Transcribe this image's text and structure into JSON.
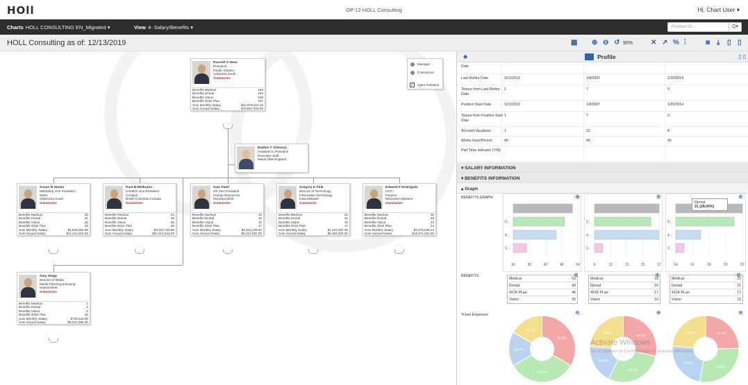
{
  "app": {
    "logo": "HOll",
    "title": "OP 12-HOLL Consulting",
    "user_menu": "Hi, Chart User ▾"
  },
  "nav": {
    "charts_label": "Charts",
    "charts_value": "HOLL CONSULTING EN_Migrated ▾",
    "view_label": "View",
    "view_value": "4- Salary/Benefits ▾",
    "position_id_placeholder": "Position ID...",
    "search_btn": "Q▾"
  },
  "page": {
    "title": "HOLL Consulting as of: 12/13/2019",
    "zoom": "90%"
  },
  "legend": {
    "manager": "Manager",
    "contractors": "Contractors",
    "open_positions": "Open Positions"
  },
  "row_labels": {
    "medical": "Benefits Medical",
    "dental": "Benefits Dental",
    "vision": "Benefits Vision",
    "k401": "Benefits 401K Plan",
    "monthly": "Sum Monthly Salary",
    "annual": "Sum Annual Salary",
    "summaries": "Summaries"
  },
  "cards": [
    {
      "name": "Russell O Hess",
      "l1": "President",
      "l2": "Pacific Eastern",
      "l3": "Arkansas,South",
      "medical": "156",
      "dental": "150",
      "vision": "108",
      "k401": "157",
      "monthly": "$10,978,210.26",
      "annual": "$79,857,403.00"
    },
    {
      "name": "Bobbie T Johnson",
      "l1": "Assistant to President",
      "l2": "Executive Staff",
      "l3": "Maine,New England"
    },
    {
      "name": "Susan N Hester",
      "l1": "Marketing Vice President",
      "l2": "Sales",
      "l3": "Oklahoma,South",
      "medical": "33",
      "dental": "31",
      "vision": "20",
      "k401": "25",
      "monthly": "$1,848,084.50",
      "annual": "$14,421,815.00"
    },
    {
      "name": "Paul M Melbrann",
      "l1": "Creative Vice President",
      "l2": "Creative",
      "l3": "British Columbia,Canada",
      "medical": "52",
      "dental": "49",
      "vision": "35",
      "k401": "46",
      "monthly": "$3,316,760.88",
      "annual": "$21,017,541.00"
    },
    {
      "name": "Sam Patel",
      "l1": "HR Vice President",
      "l2": "Human Resources",
      "l3": "Montana,West",
      "medical": "18",
      "dental": "16",
      "vision": "10",
      "k401": "17",
      "monthly": "$1,044,228.60",
      "annual": "$6,417,097.00"
    },
    {
      "name": "Gregory K Fink",
      "l1": "Director of Technology",
      "l2": "Information Technology",
      "l3": "Iowa,Midwest",
      "medical": "22",
      "dental": "21",
      "vision": "15",
      "k401": "17",
      "monthly": "$1,315,397.05",
      "annual": "$9,384,600.00"
    },
    {
      "name": "Edward P Rodriguez",
      "l1": "CFO",
      "l2": "Finance",
      "l3": "Wisconsin,Midwest",
      "medical": "30",
      "dental": "30",
      "vision": "23",
      "k401": "34",
      "monthly": "$2,370,236.24",
      "annual": "$16,871,911.00"
    },
    {
      "name": "Amy Stepp",
      "l1": "Director of Media",
      "l2": "Media Planning & Buying",
      "l3": "Hawaii,West",
      "medical": "1",
      "dental": "1",
      "vision": "0",
      "k401": "15",
      "monthly": "$728,540.00",
      "annual": "$9,521,056.00"
    }
  ],
  "profile": {
    "title": "Profile",
    "rows": [
      {
        "label": "Date",
        "v": [
          "",
          "",
          ""
        ]
      },
      {
        "label": "Last Rehire Date",
        "v": [
          "3/11/2013",
          "1/8/2007",
          "1/20/2014"
        ]
      },
      {
        "label": "Tenure from Last Rehire Date",
        "v": [
          "1",
          "7",
          "0"
        ]
      },
      {
        "label": "Position Start Date",
        "v": [
          "3/11/2013",
          "1/8/2007",
          "1/20/2014"
        ]
      },
      {
        "label": "Tenure from Position Start Date",
        "v": [
          "1",
          "7",
          "0"
        ]
      },
      {
        "label": "Accrued Vacations",
        "v": [
          "1",
          "12",
          "8"
        ]
      },
      {
        "label": "Works Hour/Period",
        "v": [
          "40",
          "40",
          "40"
        ]
      },
      {
        "label": "Part Time indicator (Y/N)",
        "v": [
          "",
          "",
          ""
        ]
      }
    ],
    "sections": {
      "salary": "SALARY INFORMATION",
      "benefits": "BENEFITS INFORMATION",
      "graph": "Graph"
    },
    "benefits_graph_label": "BENEFITS GRAPH",
    "benefits_label": "BENEFITS",
    "travel_label": "Travel Expenses",
    "tooltip": {
      "line1": "Dental",
      "line2": "21 (28.00%)"
    },
    "watermark": {
      "line1": "Activate Windows",
      "line2": "Go to System in Control Panel to activate Windows."
    }
  },
  "benefit_tables": [
    [
      {
        "k": "Medical",
        "v": "52"
      },
      {
        "k": "Dental",
        "v": "49"
      },
      {
        "k": "401K PLan",
        "v": "46"
      },
      {
        "k": "Vision",
        "v": "35"
      }
    ],
    [
      {
        "k": "Medical",
        "v": "18"
      },
      {
        "k": "Dental",
        "v": "16"
      },
      {
        "k": "401K PLan",
        "v": "17"
      },
      {
        "k": "Vision",
        "v": "10"
      }
    ],
    [
      {
        "k": "Medical",
        "v": "22"
      },
      {
        "k": "Dental",
        "v": "21"
      },
      {
        "k": "401K PLan",
        "v": "17"
      },
      {
        "k": "Vision",
        "v": "15"
      }
    ]
  ],
  "chart_data": [
    {
      "type": "bar",
      "categories": [
        "",
        "D...",
        "4...",
        "V..."
      ],
      "values": [
        52,
        49,
        46,
        35
      ],
      "xticks": [
        "30",
        "36",
        "42",
        "48",
        "54"
      ],
      "xlim": [
        30,
        54
      ],
      "colors": [
        "#b9b9bd",
        "#b8e8b8",
        "#c5dcf2",
        "#f5c7e6"
      ]
    },
    {
      "type": "bar",
      "categories": [
        "",
        "D...",
        "4...",
        "V..."
      ],
      "values": [
        18,
        16,
        17,
        10
      ],
      "xticks": [
        "9",
        "11",
        "13",
        "15",
        "17"
      ],
      "xlim": [
        9,
        17
      ],
      "colors": [
        "#b9b9bd",
        "#b8e8b8",
        "#c5dcf2",
        "#f5c7e6"
      ]
    },
    {
      "type": "bar",
      "categories": [
        "",
        "D...",
        "4...",
        "V..."
      ],
      "values": [
        22,
        21,
        17,
        15
      ],
      "xticks": [
        "14",
        "16",
        "18",
        "20",
        "22"
      ],
      "xlim": [
        14,
        22
      ],
      "colors": [
        "#b9b9bd",
        "#b8e8b8",
        "#c5dcf2",
        "#f5c7e6"
      ]
    },
    {
      "type": "pie",
      "labels": [
        "",
        "",
        "",
        ""
      ],
      "values": [
        33.3,
        33.3,
        16.7,
        16.7
      ],
      "data_labels": [
        "33.3%",
        "33.3%",
        "16.7%",
        "16.7%"
      ],
      "colors": [
        "#f3a7a7",
        "#b9e9b2",
        "#b9d3f0",
        "#f3df8c"
      ]
    },
    {
      "type": "pie",
      "labels": [
        "",
        "",
        "",
        ""
      ],
      "values": [
        28.6,
        28.6,
        19.0,
        23.8
      ],
      "data_labels": [
        "28.6%",
        "28.6%",
        "19.0%",
        "23.8%"
      ],
      "colors": [
        "#f3a7a7",
        "#b9e9b2",
        "#b9d3f0",
        "#f3df8c"
      ]
    },
    {
      "type": "pie",
      "labels": [
        "",
        "",
        "",
        ""
      ],
      "values": [
        24.7,
        28.1,
        23.5,
        23.5
      ],
      "data_labels": [
        "24.7%",
        "28.1%",
        "23.5%",
        "23.5%"
      ],
      "colors": [
        "#f3a7a7",
        "#b9e9b2",
        "#b9d3f0",
        "#f3df8c"
      ]
    }
  ]
}
